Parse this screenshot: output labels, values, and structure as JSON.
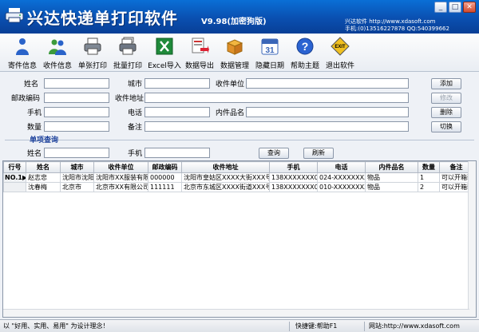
{
  "titlebar": {
    "title": "兴达快递单打印软件",
    "version": "V9.98(加密狗版)",
    "company_line1": "兴达软件  http://www.xdasoft.com",
    "company_line2": "手机:(0)13516227878 QQ:540399662",
    "minimize": "_",
    "maximize": "□",
    "close": "✕"
  },
  "toolbar": {
    "items": [
      {
        "label": "寄件信息",
        "icon": "sender-person-icon"
      },
      {
        "label": "收件信息",
        "icon": "recipient-people-icon"
      },
      {
        "label": "单张打印",
        "icon": "printer-icon"
      },
      {
        "label": "批量打印",
        "icon": "batch-printer-icon"
      },
      {
        "label": "Excel导入",
        "icon": "excel-icon"
      },
      {
        "label": "数据导出",
        "icon": "export-icon"
      },
      {
        "label": "数据管理",
        "icon": "database-box-icon"
      },
      {
        "label": "隐藏日期",
        "icon": "calendar-31-icon"
      },
      {
        "label": "帮助主题",
        "icon": "help-icon"
      },
      {
        "label": "退出软件",
        "icon": "exit-sign-icon"
      }
    ]
  },
  "form": {
    "name_label": "姓名",
    "city_label": "城市",
    "company_label": "收件单位",
    "postcode_label": "邮政编码",
    "address_label": "收件地址",
    "mobile_label": "手机",
    "phone_label": "电话",
    "goods_label": "内件品名",
    "quantity_label": "数量",
    "remark_label": "备注",
    "add_button": "添加",
    "edit_button": "修改",
    "delete_button": "删除",
    "switch_button": "切换"
  },
  "search": {
    "section_title": "单项查询",
    "name_label": "姓名",
    "mobile_label": "手机",
    "query_button": "查询",
    "refresh_button": "刷新"
  },
  "grid": {
    "columns": [
      "行号",
      "姓名",
      "城市",
      "收件单位",
      "邮政编码",
      "收件地址",
      "手机",
      "电话",
      "内件品名",
      "数量",
      "备注"
    ],
    "rows": [
      [
        "NO.1",
        "赵志忠",
        "沈阳市沈阳",
        "沈阳市XX服装有限",
        "000000",
        "沈阳市皇姑区XXXX大街XXX号",
        "138XXXXXXX0",
        "024-XXXXXXXX",
        "物品",
        "1",
        "可以开箱验货"
      ],
      [
        "",
        "沈春梅",
        "北京市",
        "北京市XX有限公司",
        "111111",
        "北京市东城区XXXX街道XXX号",
        "138XXXXXXX0",
        "010-XXXXXXXX",
        "物品",
        "2",
        "可以开箱验货"
      ]
    ],
    "current_row_marker": "▶"
  },
  "statusbar": {
    "slogan": "以 \"好用、实用、易用\" 为设计理念！",
    "shortcut": "快捷键:帮助F1",
    "website": "网站:http://www.xdasoft.com"
  },
  "colors": {
    "titlebar": "#0a5fc4",
    "section_title": "#1a3f9a",
    "window_bg": "#eef1f6"
  }
}
